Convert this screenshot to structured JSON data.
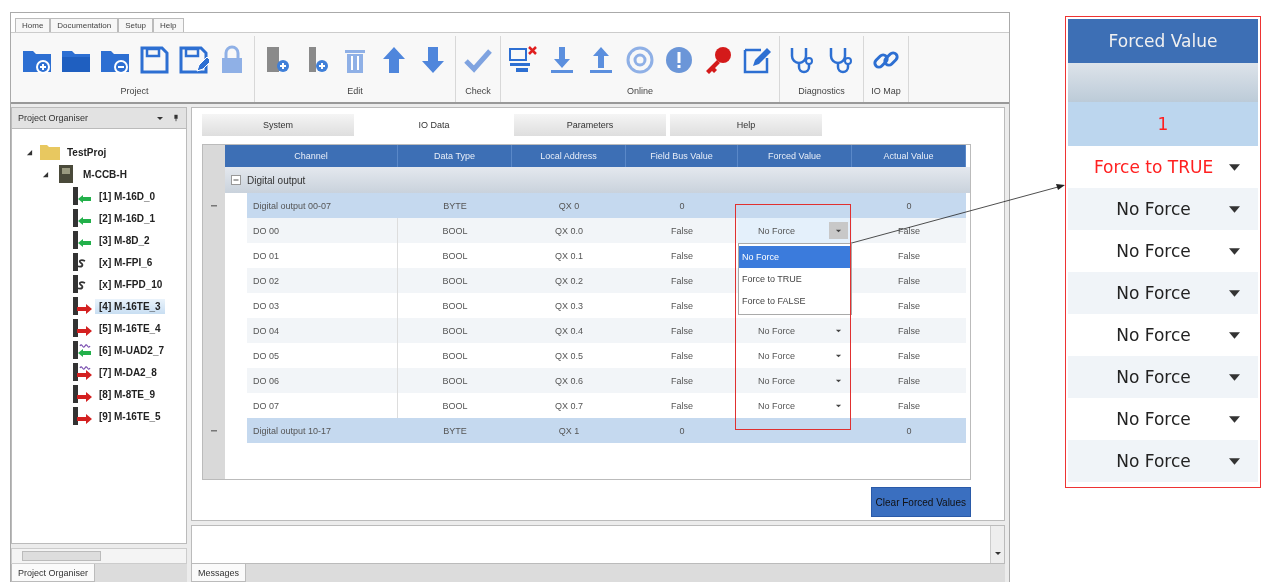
{
  "menu_tabs": [
    "Home",
    "Documentation",
    "Setup",
    "Help"
  ],
  "ribbon_groups": [
    {
      "label": "Project",
      "tools": [
        {
          "kind": "folder-plus"
        },
        {
          "kind": "folder"
        },
        {
          "kind": "folder-minus"
        },
        {
          "kind": "floppy"
        },
        {
          "kind": "floppy-pen"
        },
        {
          "kind": "lock"
        }
      ]
    },
    {
      "label": "Edit",
      "tools": [
        {
          "kind": "module-plus"
        },
        {
          "kind": "module-plus-small"
        },
        {
          "kind": "trash"
        },
        {
          "kind": "arrow-up"
        },
        {
          "kind": "arrow-down"
        }
      ]
    },
    {
      "label": "Check",
      "tools": [
        {
          "kind": "check"
        }
      ]
    },
    {
      "label": "Online",
      "tools": [
        {
          "kind": "computer-x"
        },
        {
          "kind": "download"
        },
        {
          "kind": "upload"
        },
        {
          "kind": "disc"
        },
        {
          "kind": "info"
        },
        {
          "kind": "key"
        },
        {
          "kind": "pencil"
        }
      ]
    },
    {
      "label": "Diagnostics",
      "tools": [
        {
          "kind": "stethoscope"
        },
        {
          "kind": "stethoscope"
        }
      ]
    },
    {
      "label": "IO Map",
      "tools": [
        {
          "kind": "link"
        }
      ]
    }
  ],
  "sidebar": {
    "title": "Project Organiser",
    "tree": [
      {
        "label": "TestProj",
        "kind": "folder",
        "expanded": true,
        "selected": false,
        "children": [
          {
            "label": "M-CCB-H",
            "kind": "controller",
            "expanded": true,
            "selected": false,
            "children": [
              {
                "label": "[1] M-16D_0",
                "kind": "input",
                "selected": false
              },
              {
                "label": "[2] M-16D_1",
                "kind": "input",
                "selected": false
              },
              {
                "label": "[3] M-8D_2",
                "kind": "input",
                "selected": false
              },
              {
                "label": "[x] M-FPI_6",
                "kind": "safety",
                "selected": false
              },
              {
                "label": "[x] M-FPD_10",
                "kind": "safety",
                "selected": false
              },
              {
                "label": "[4] M-16TE_3",
                "kind": "output",
                "selected": true
              },
              {
                "label": "[5] M-16TE_4",
                "kind": "output",
                "selected": false
              },
              {
                "label": "[6] M-UAD2_7",
                "kind": "analog-in",
                "selected": false
              },
              {
                "label": "[7] M-DA2_8",
                "kind": "analog-out",
                "selected": false
              },
              {
                "label": "[8] M-8TE_9",
                "kind": "output",
                "selected": false
              },
              {
                "label": "[9] M-16TE_5",
                "kind": "output",
                "selected": false
              }
            ]
          }
        ]
      }
    ],
    "bottom_tabs": [
      {
        "label": "Project Organiser",
        "selected": true
      }
    ]
  },
  "editor_tabs": [
    {
      "label": "System",
      "selected": false
    },
    {
      "label": "IO Data",
      "selected": true
    },
    {
      "label": "Parameters",
      "selected": false
    },
    {
      "label": "Help",
      "selected": false
    }
  ],
  "table": {
    "columns": [
      "Channel",
      "Data Type",
      "Local Address",
      "Field Bus Value",
      "Forced Value",
      "Actual Value"
    ],
    "groups": [
      {
        "label": "Digital output",
        "expanded": true,
        "rows": [
          {
            "kind": "byte",
            "channel": "Digital output 00-07",
            "data_type": "BYTE",
            "local_address": "QX 0",
            "field_bus_value": "0",
            "actual_value": "0"
          },
          {
            "kind": "bit",
            "channel": "DO 00",
            "data_type": "BOOL",
            "local_address": "QX 0.0",
            "field_bus_value": "False",
            "forced_value": "No Force",
            "dropdown_open": true,
            "actual_value": "False"
          },
          {
            "kind": "bit",
            "channel": "DO 01",
            "data_type": "BOOL",
            "local_address": "QX 0.1",
            "field_bus_value": "False",
            "actual_value": "False"
          },
          {
            "kind": "bit",
            "channel": "DO 02",
            "data_type": "BOOL",
            "local_address": "QX 0.2",
            "field_bus_value": "False",
            "actual_value": "False"
          },
          {
            "kind": "bit",
            "channel": "DO 03",
            "data_type": "BOOL",
            "local_address": "QX 0.3",
            "field_bus_value": "False",
            "actual_value": "False"
          },
          {
            "kind": "bit",
            "channel": "DO 04",
            "data_type": "BOOL",
            "local_address": "QX 0.4",
            "field_bus_value": "False",
            "forced_value": "No Force",
            "dropdown_open": false,
            "actual_value": "False"
          },
          {
            "kind": "bit",
            "channel": "DO 05",
            "data_type": "BOOL",
            "local_address": "QX 0.5",
            "field_bus_value": "False",
            "forced_value": "No Force",
            "dropdown_open": false,
            "actual_value": "False"
          },
          {
            "kind": "bit",
            "channel": "DO 06",
            "data_type": "BOOL",
            "local_address": "QX 0.6",
            "field_bus_value": "False",
            "forced_value": "No Force",
            "dropdown_open": false,
            "actual_value": "False"
          },
          {
            "kind": "bit",
            "channel": "DO 07",
            "data_type": "BOOL",
            "local_address": "QX 0.7",
            "field_bus_value": "False",
            "forced_value": "No Force",
            "dropdown_open": false,
            "actual_value": "False"
          },
          {
            "kind": "byte",
            "channel": "Digital output 10-17",
            "data_type": "BYTE",
            "local_address": "QX 1",
            "field_bus_value": "0",
            "actual_value": "0"
          }
        ]
      }
    ],
    "dropdown_options": [
      {
        "label": "No Force",
        "selected": true
      },
      {
        "label": "Force to TRUE",
        "selected": false
      },
      {
        "label": "Force to FALSE",
        "selected": false
      }
    ]
  },
  "clear_button": "Clear Forced Values",
  "messages": {
    "tabs": [
      {
        "label": "Messages",
        "selected": true
      }
    ]
  },
  "callout": {
    "header": "Forced Value",
    "byte_row": {
      "value": "1",
      "forced": true
    },
    "rows": [
      {
        "value": "Force to TRUE",
        "forced": true
      },
      {
        "value": "No Force",
        "forced": false
      },
      {
        "value": "No Force",
        "forced": false
      },
      {
        "value": "No Force",
        "forced": false
      },
      {
        "value": "No Force",
        "forced": false
      },
      {
        "value": "No Force",
        "forced": false
      },
      {
        "value": "No Force",
        "forced": false
      },
      {
        "value": "No Force",
        "forced": false
      }
    ]
  }
}
